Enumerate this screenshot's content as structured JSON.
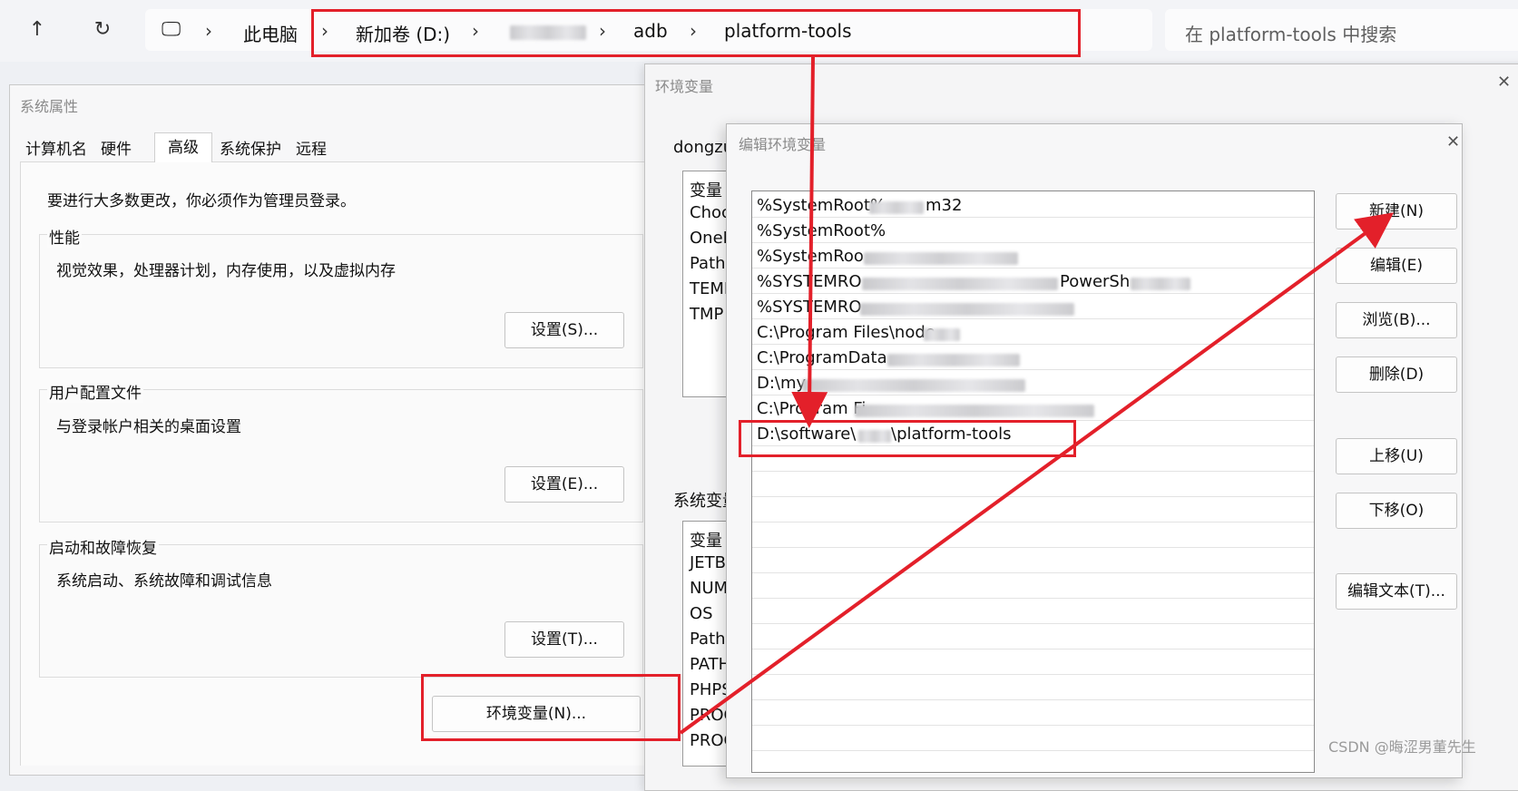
{
  "explorer": {
    "up_glyph": "↑",
    "refresh_glyph": "↻",
    "computer_glyph": "🖵",
    "separator": "›",
    "breadcrumbs": [
      "此电脑",
      "新加卷 (D:)",
      "adb",
      "platform-tools"
    ],
    "search_placeholder": "在 platform-tools 中搜索"
  },
  "system_properties": {
    "title": "系统属性",
    "tabs": [
      "计算机名",
      "硬件",
      "高级",
      "系统保护",
      "远程"
    ],
    "selected_tab": "高级",
    "admin_notice": "要进行大多数更改，你必须作为管理员登录。",
    "performance": {
      "heading": "性能",
      "description": "视觉效果，处理器计划，内存使用，以及虚拟内存",
      "button": "设置(S)..."
    },
    "user_profiles": {
      "heading": "用户配置文件",
      "description": "与登录帐户相关的桌面设置",
      "button": "设置(E)..."
    },
    "startup_recovery": {
      "heading": "启动和故障恢复",
      "description": "系统启动、系统故障和调试信息",
      "button": "设置(T)..."
    },
    "env_button": "环境变量(N)..."
  },
  "environment_variables": {
    "title": "环境变量",
    "user_section_label": "dongzu",
    "user_vars_header": "变量",
    "user_vars": [
      "Choc",
      "OneD",
      "Path",
      "TEMF",
      "TMP"
    ],
    "system_section_label": "系统变量",
    "system_vars_header": "变量",
    "system_vars": [
      "JETBF",
      "NUM",
      "OS",
      "Path",
      "PATH",
      "PHPS",
      "PROC",
      "PROC"
    ]
  },
  "edit_dialog": {
    "title": "编辑环境变量",
    "close_glyph": "✕",
    "path_entries": [
      "%SystemRoot%",
      "%SystemRoot%",
      "%SystemRoo",
      "%SYSTEMRO",
      "%SYSTEMRO",
      "C:\\Program Files\\node",
      "C:\\ProgramData",
      "D:\\my",
      "C:\\Program Fi",
      "D:\\software\\"
    ],
    "path_entry_tails": [
      "m32",
      "",
      "",
      "PowerSh",
      "",
      "",
      "",
      "",
      "",
      "\\platform-tools"
    ],
    "buttons": {
      "new": "新建(N)",
      "edit": "编辑(E)",
      "browse": "浏览(B)...",
      "delete": "删除(D)",
      "move_up": "上移(U)",
      "move_down": "下移(O)",
      "edit_text": "编辑文本(T)..."
    }
  },
  "annotation_color": "#e3202a",
  "watermark": "CSDN @晦涩男董先生"
}
